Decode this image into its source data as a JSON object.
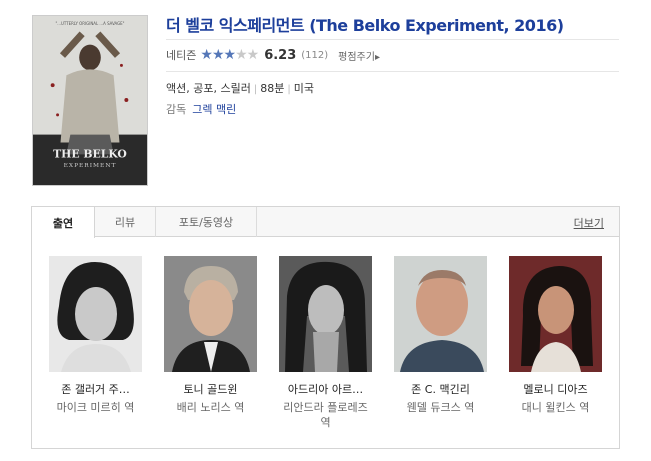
{
  "movie": {
    "title": "더 벨코 익스페리먼트 (The Belko Experiment, 2016)",
    "rating_label": "네티즌",
    "stars_filled": 3,
    "stars_total": 5,
    "score": "6.23",
    "votes": "(112)",
    "rate_link": "평점주기▸",
    "genres": "액션, 공포, 스릴러",
    "runtime": "88분",
    "country": "미국",
    "director_label": "감독",
    "director": "그렉 맥린",
    "poster": {
      "tagline": "\"...UTTERLY ORIGINAL ...A SAVAGE\"",
      "logo_line1": "THE BELKO",
      "logo_line2": "EXPERIMENT"
    }
  },
  "tabs": [
    {
      "label": "출연",
      "active": true
    },
    {
      "label": "리뷰",
      "active": false
    },
    {
      "label": "포토/동영상",
      "active": false
    }
  ],
  "more_label": "더보기",
  "cast": [
    {
      "name": "존 갤러거 주…",
      "role": "마이크 미르히 역"
    },
    {
      "name": "토니 골드윈",
      "role": "배리 노리스 역"
    },
    {
      "name": "아드리아 아르…",
      "role": "리안드라 플로레즈 역"
    },
    {
      "name": "존 C. 맥긴리",
      "role": "웬델 듀크스 역"
    },
    {
      "name": "멜로니 디아즈",
      "role": "대니 윌킨스 역"
    }
  ]
}
